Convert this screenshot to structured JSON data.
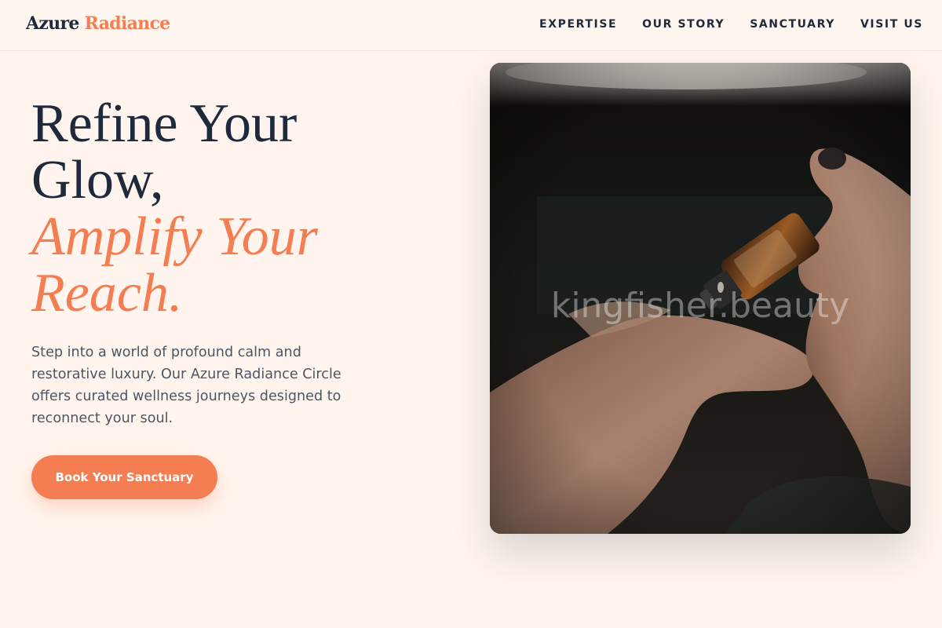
{
  "brand": {
    "part1": "Azure",
    "part2": "Radiance"
  },
  "nav": {
    "items": [
      "EXPERTISE",
      "OUR STORY",
      "SANCTUARY",
      "VISIT US"
    ]
  },
  "hero": {
    "title_line1": "Refine Your",
    "title_line2": "Glow,",
    "accent_line1": "Amplify Your",
    "accent_line2": "Reach.",
    "description": "Step into a world of profound calm and restorative luxury. Our Azure Radiance Circle offers curated wellness journeys designed to reconnect your soul.",
    "cta_label": "Book Your Sanctuary"
  },
  "photo": {
    "watermark": "kingfisher.beauty"
  },
  "colors": {
    "accent": "#f47e52",
    "navy": "#1e2a3b",
    "background": "#fff5ee"
  }
}
